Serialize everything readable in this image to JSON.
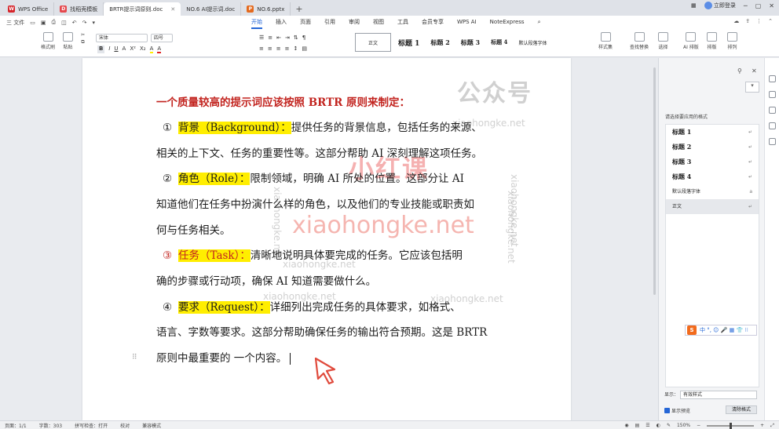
{
  "tabs": [
    {
      "label": "WPS Office",
      "icon": "wps-icon",
      "active": false
    },
    {
      "label": "找稻壳模板",
      "icon": "template-icon",
      "active": false
    },
    {
      "label": "BRTR提示词原则.doc",
      "icon": "doc-icon",
      "active": true
    },
    {
      "label": "NO.6 AI提示词.doc",
      "icon": "doc-icon",
      "active": false
    },
    {
      "label": "NO.6.pptx",
      "icon": "ppt-icon",
      "active": false
    }
  ],
  "tabbar_right": {
    "user": "立即登录"
  },
  "menu": {
    "file_label": "三 文件",
    "tabs": [
      "开始",
      "插入",
      "页面",
      "引用",
      "审阅",
      "视图",
      "工具",
      "会员专享",
      "WPS AI",
      "NoteExpress"
    ],
    "active_tab": "开始"
  },
  "ribbon": {
    "format_painter": "格式刷",
    "paste": "粘贴",
    "font_name": "宋体",
    "font_size": "四号",
    "format_buttons": [
      "B",
      "I",
      "U",
      "A",
      "X²",
      "X₂",
      "A",
      "A"
    ],
    "styles": [
      "正文",
      "标题 1",
      "标题 2",
      "标题 3",
      "标题 4",
      "默认段落字体"
    ],
    "right_labels": [
      "样式集",
      "查找替换",
      "选择",
      "AI 排版",
      "排版",
      "排列"
    ]
  },
  "document": {
    "heading": "一个质量较高的提示词应该按照 BRTR 原则来制定：",
    "items": [
      {
        "num": "①",
        "term": "背景（Background）：",
        "text_first": "提供任务的背景信息，包括任务的来源、",
        "text_rest": [
          "相关的上下文、任务的重要性等。这部分帮助 AI 深刻理解这项任务。"
        ]
      },
      {
        "num": "②",
        "term": "角色（Role）：",
        "text_first": "限制领域，明确 AI 所处的位置。这部分让 AI",
        "text_rest": [
          "知道他们在任务中扮演什么样的角色，以及他们的专业技能或职责如",
          "何与任务相关。"
        ]
      },
      {
        "num": "③",
        "term": "任务（Task）：",
        "text_first": "清晰地说明具体要完成的任务。它应该包括明",
        "text_rest": [
          "确的步骤或行动项，确保 AI 知道需要做什么。"
        ]
      },
      {
        "num": "④",
        "term": "要求（Request）：",
        "text_first": "详细列出完成任务的具体要求，如格式、",
        "text_rest": [
          "语言、字数等要求。这部分帮助确保任务的输出符合预期。这是 BRTR",
          "原则中最重要的 一个内容。"
        ]
      }
    ]
  },
  "watermarks": {
    "brand_cn": "小红课",
    "brand_en": "xiaohongke.net",
    "small": "xiaohongke.net",
    "gzh": "公众号"
  },
  "right_pane": {
    "title": "请选择要应用的格式",
    "styles": [
      {
        "label": "标题 1",
        "mark": "↵"
      },
      {
        "label": "标题 2",
        "mark": "↵"
      },
      {
        "label": "标题 3",
        "mark": "↵"
      },
      {
        "label": "标题 4",
        "mark": "↵"
      },
      {
        "label": "默认段落字体",
        "mark": "a"
      },
      {
        "label": "正文",
        "mark": "↵"
      }
    ],
    "show_label": "显示：",
    "show_value": "有效样式",
    "preview_label": "显示预览",
    "clear_button": "清除格式"
  },
  "ime": {
    "logo": "S",
    "text": "中 °, ☺ 🎤 ▦ 👕 ⁝⁝"
  },
  "status": {
    "page": "页面：1/1",
    "words": "字数：303",
    "spell": "拼写检查：打开",
    "proof": "校对",
    "compat": "兼容模式",
    "zoom": "150%",
    "zoom_fraction": 0.5
  }
}
